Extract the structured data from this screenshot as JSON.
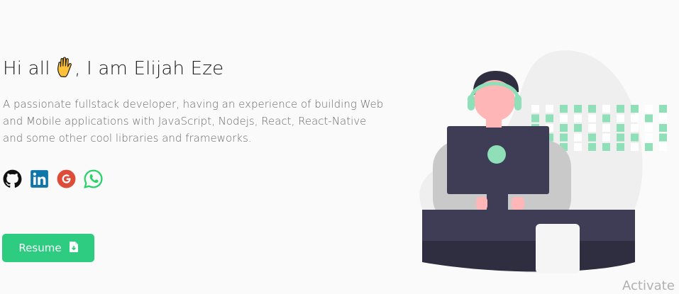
{
  "hero": {
    "greeting_prefix": "Hi all",
    "greeting_suffix": ", I am Elijah Eze",
    "subtitle": "A passionate fullstack developer, having an experience of building Web and Mobile applications with JavaScript, Nodejs, React, React-Native and some other cool libraries and frameworks."
  },
  "socials": [
    {
      "name": "github",
      "icon": "github-icon",
      "color": "#111111"
    },
    {
      "name": "linkedin",
      "icon": "linkedin-icon",
      "color": "#0e76a8"
    },
    {
      "name": "google",
      "icon": "google-icon",
      "color": "#dd4b39"
    },
    {
      "name": "whatsapp",
      "icon": "whatsapp-icon",
      "color": "#25d366"
    }
  ],
  "resume": {
    "label": "Resume",
    "icon": "file-download-icon",
    "color": "#2ecc80"
  },
  "watermark": "Activate V",
  "colors": {
    "accent": "#2ecc80",
    "illustration_green": "#8fdfb8",
    "illustration_dark": "#3f3d56",
    "skin": "#ffb6b6"
  }
}
